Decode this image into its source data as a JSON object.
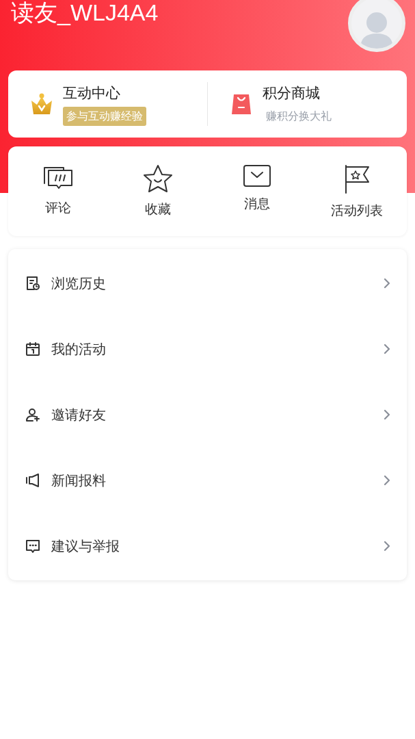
{
  "profile": {
    "username": "读友_WLJ4A4"
  },
  "promo_cards": [
    {
      "kind": "interaction",
      "title": "互动中心",
      "subtitle": "参与互动赚经验"
    },
    {
      "kind": "mall",
      "title": "积分商城",
      "subtitle": "赚积分换大礼"
    }
  ],
  "shortcuts": [
    {
      "kind": "comment",
      "label": "评论"
    },
    {
      "kind": "favorite",
      "label": "收藏"
    },
    {
      "kind": "message",
      "label": "消息"
    },
    {
      "kind": "events",
      "label": "活动列表"
    }
  ],
  "menu": [
    {
      "kind": "history",
      "label": "浏览历史"
    },
    {
      "kind": "activity",
      "label": "我的活动"
    },
    {
      "kind": "invite",
      "label": "邀请好友"
    },
    {
      "kind": "report",
      "label": "新闻报料"
    },
    {
      "kind": "feedback",
      "label": "建议与举报"
    }
  ]
}
